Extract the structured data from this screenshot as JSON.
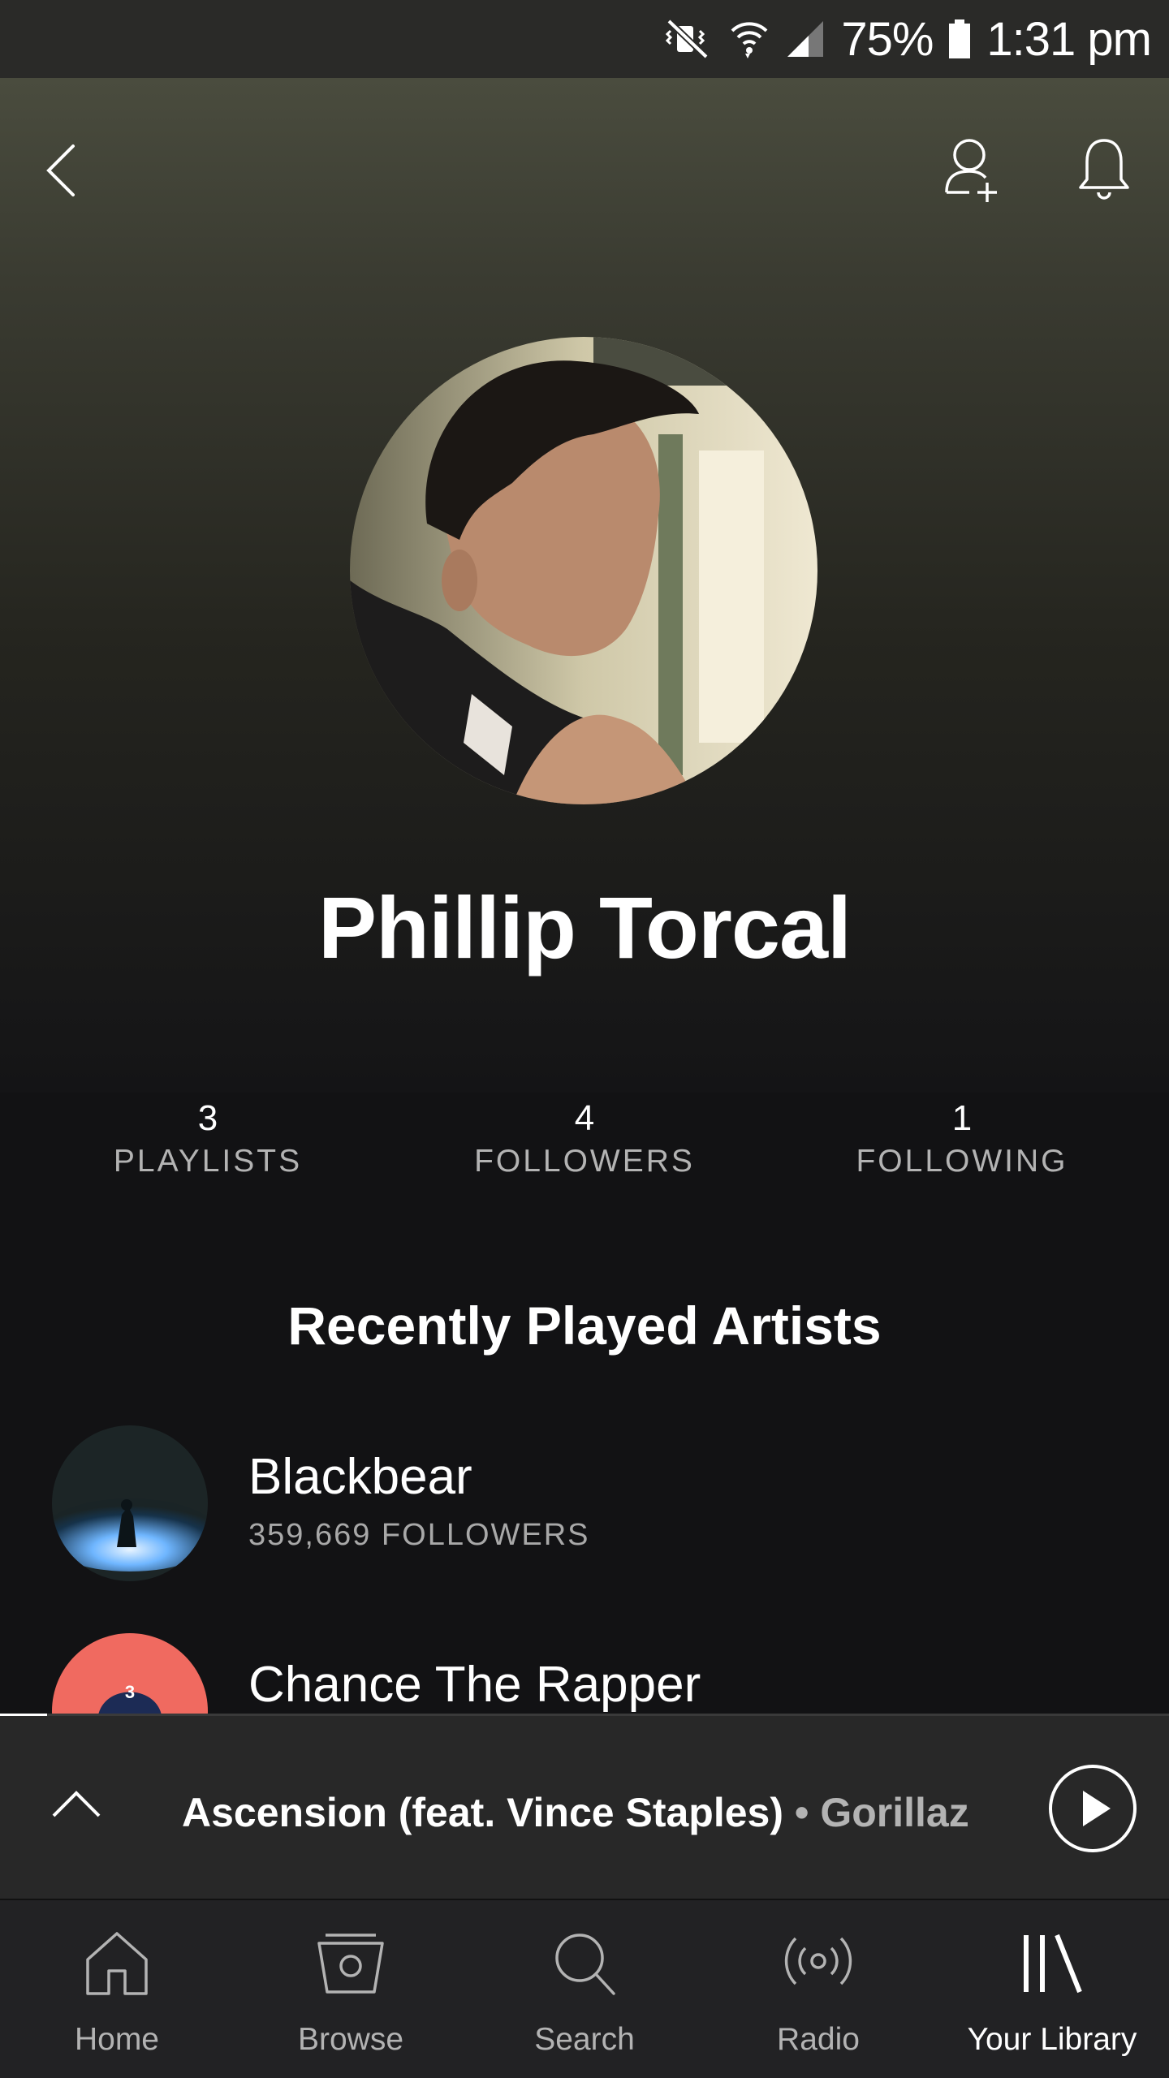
{
  "status_bar": {
    "battery": "75%",
    "time": "1:31 pm",
    "icons": [
      "mute-vibrate-icon",
      "wifi-icon",
      "signal-icon",
      "battery-icon"
    ]
  },
  "header": {
    "back_icon": "back-chevron-icon",
    "follow_icon": "add-user-icon",
    "notifications_icon": "bell-icon"
  },
  "profile": {
    "name": "Phillip Torcal",
    "stats": [
      {
        "count": "3",
        "label": "PLAYLISTS"
      },
      {
        "count": "4",
        "label": "FOLLOWERS"
      },
      {
        "count": "1",
        "label": "FOLLOWING"
      }
    ]
  },
  "recently_played": {
    "title": "Recently Played Artists",
    "artists": [
      {
        "name": "Blackbear",
        "followers": "359,669 FOLLOWERS"
      },
      {
        "name": "Chance The Rapper",
        "followers": ""
      }
    ]
  },
  "now_playing": {
    "title": "Ascension (feat. Vince Staples)",
    "separator": "•",
    "artist": "Gorillaz"
  },
  "nav": {
    "items": [
      {
        "label": "Home",
        "icon": "home-icon"
      },
      {
        "label": "Browse",
        "icon": "browse-icon"
      },
      {
        "label": "Search",
        "icon": "search-icon"
      },
      {
        "label": "Radio",
        "icon": "radio-icon"
      },
      {
        "label": "Your Library",
        "icon": "library-icon",
        "active": true
      }
    ]
  },
  "colors": {
    "background": "#121214",
    "accent_white": "#ffffff",
    "muted_text": "#b3b3b3",
    "player_bg": "#282828",
    "nav_bg": "#222224"
  }
}
